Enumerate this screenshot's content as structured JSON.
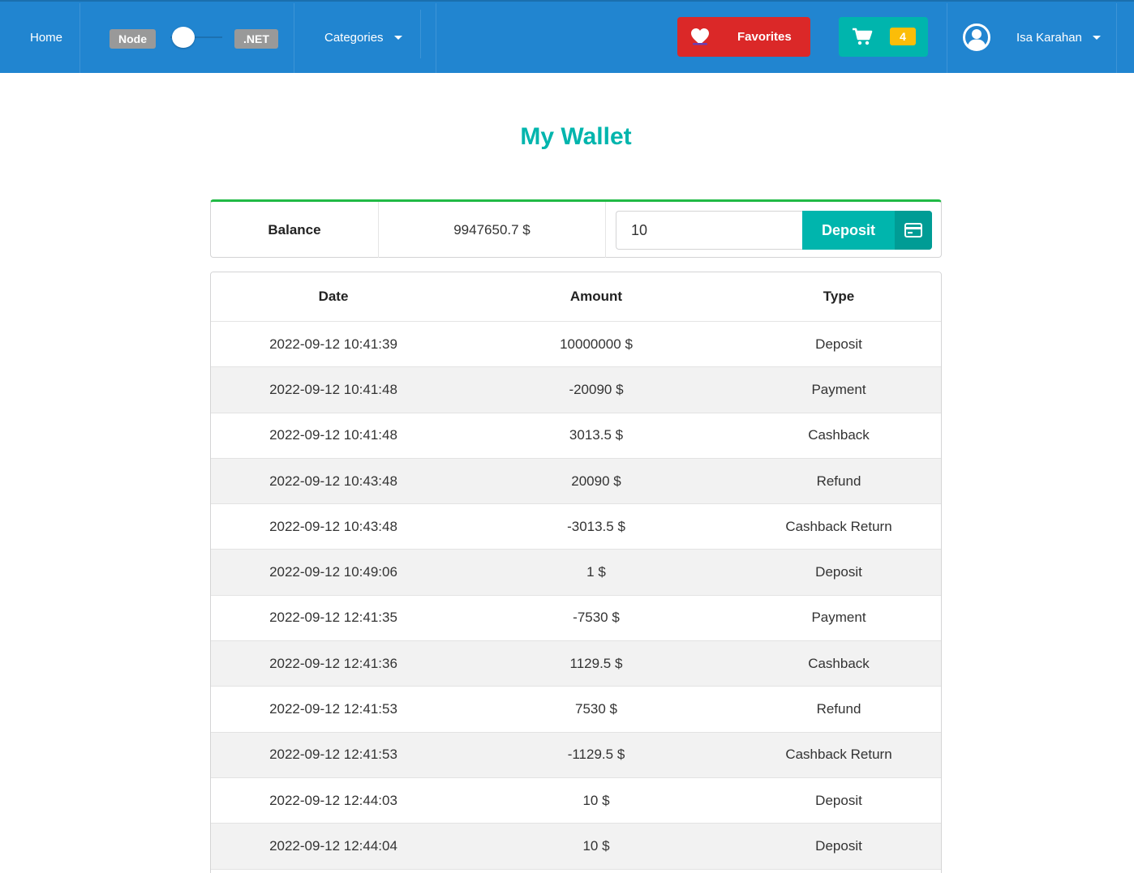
{
  "nav": {
    "home": "Home",
    "toggle_left": "Node",
    "toggle_right": ".NET",
    "categories": "Categories",
    "favorites": "Favorites",
    "cart_count": "4",
    "user_name": "Isa Karahan"
  },
  "colors": {
    "navbar": "#2185d0",
    "favorites": "#db2828",
    "cart": "#00b5ad",
    "cart_badge": "#fbbd08",
    "title": "#00b5ad",
    "balance_accent": "#21ba45"
  },
  "page": {
    "title": "My Wallet"
  },
  "balance": {
    "label": "Balance",
    "value": "9947650.7 $",
    "deposit_value": "10",
    "deposit_button": "Deposit"
  },
  "table": {
    "headers": {
      "date": "Date",
      "amount": "Amount",
      "type": "Type"
    },
    "rows": [
      {
        "date": "2022-09-12 10:41:39",
        "amount": "10000000 $",
        "type": "Deposit"
      },
      {
        "date": "2022-09-12 10:41:48",
        "amount": "-20090 $",
        "type": "Payment"
      },
      {
        "date": "2022-09-12 10:41:48",
        "amount": "3013.5 $",
        "type": "Cashback"
      },
      {
        "date": "2022-09-12 10:43:48",
        "amount": "20090 $",
        "type": "Refund"
      },
      {
        "date": "2022-09-12 10:43:48",
        "amount": "-3013.5 $",
        "type": "Cashback Return"
      },
      {
        "date": "2022-09-12 10:49:06",
        "amount": "1 $",
        "type": "Deposit"
      },
      {
        "date": "2022-09-12 12:41:35",
        "amount": "-7530 $",
        "type": "Payment"
      },
      {
        "date": "2022-09-12 12:41:36",
        "amount": "1129.5 $",
        "type": "Cashback"
      },
      {
        "date": "2022-09-12 12:41:53",
        "amount": "7530 $",
        "type": "Refund"
      },
      {
        "date": "2022-09-12 12:41:53",
        "amount": "-1129.5 $",
        "type": "Cashback Return"
      },
      {
        "date": "2022-09-12 12:44:03",
        "amount": "10 $",
        "type": "Deposit"
      },
      {
        "date": "2022-09-12 12:44:04",
        "amount": "10 $",
        "type": "Deposit"
      }
    ]
  }
}
